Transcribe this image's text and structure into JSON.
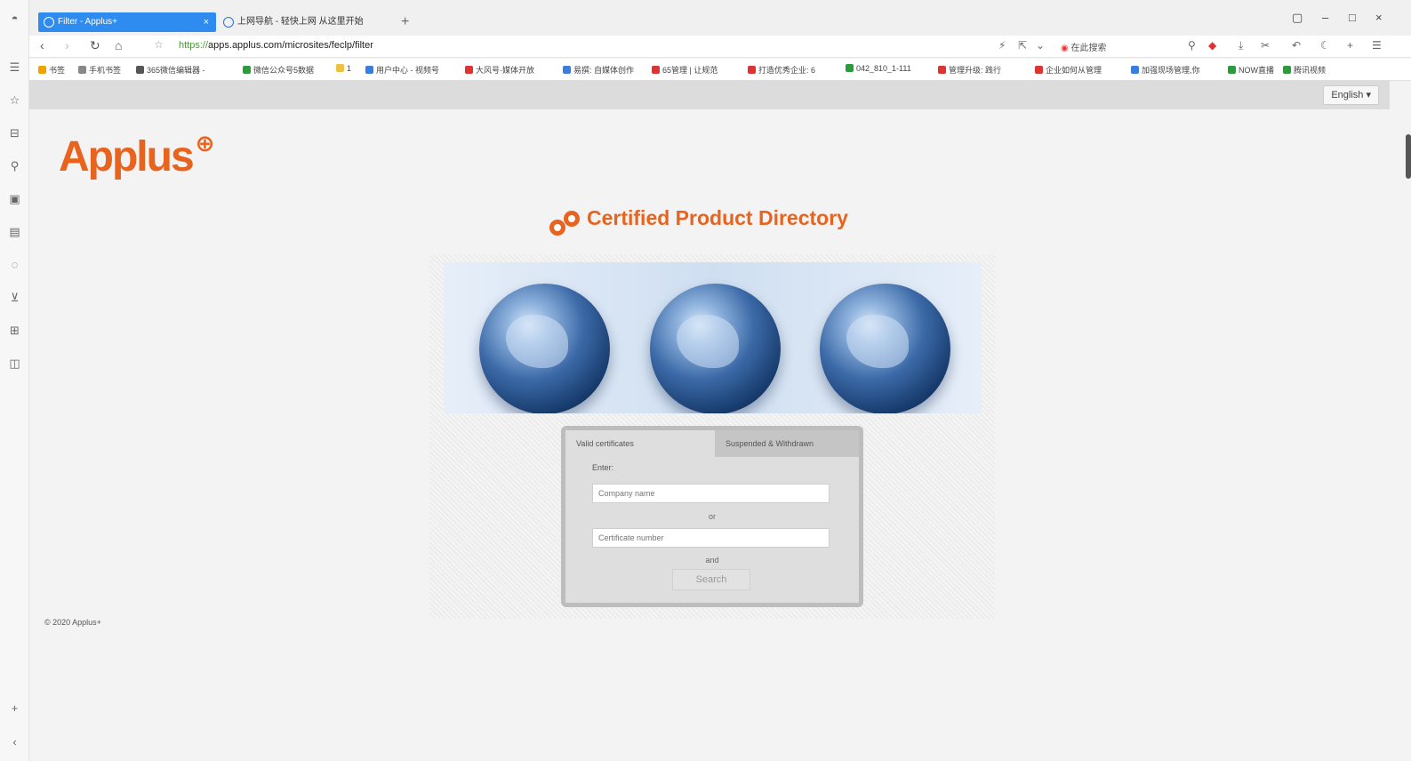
{
  "browser": {
    "tabs": [
      {
        "label": "Filter - Applus+",
        "active": true
      },
      {
        "label": "上网导航 - 轻快上网 从这里开始",
        "active": false
      }
    ],
    "new_tab": "+",
    "url_scheme": "https://",
    "url_rest": "apps.applus.com/microsites/feclp/filter",
    "search_engine": "在此搜索",
    "window_controls": [
      "▢",
      "–",
      "□",
      "×"
    ]
  },
  "bookmarks": [
    {
      "label": "书签",
      "color": "#f2a100"
    },
    {
      "label": "手机书签",
      "color": "#888888"
    },
    {
      "label": "365微信编辑器 -",
      "color": "#555555"
    },
    {
      "label": "微信公众号5数据",
      "color": "#2a9d3a"
    },
    {
      "label": "1",
      "color": "#f0c040"
    },
    {
      "label": "用户中心 - 视频号",
      "color": "#3a7de0"
    },
    {
      "label": "大风号·媒体开放",
      "color": "#d33"
    },
    {
      "label": "易撰: 自媒体创作",
      "color": "#3a7de0"
    },
    {
      "label": "65管理 | 让规范",
      "color": "#d33"
    },
    {
      "label": "打造优秀企业: 6",
      "color": "#d33"
    },
    {
      "label": "042_810_1-111",
      "color": "#2a9d3a"
    },
    {
      "label": "管理升级: 践行",
      "color": "#d33"
    },
    {
      "label": "企业如何从管理",
      "color": "#d33"
    },
    {
      "label": "加强现场管理,你",
      "color": "#3a7de0"
    },
    {
      "label": "NOW直播",
      "color": "#2a9d3a"
    },
    {
      "label": "腾讯视频",
      "color": "#2a9d3a"
    }
  ],
  "page": {
    "language": "English ▾",
    "logo_text": "Applus",
    "logo_mark": "⊕",
    "directory_title": "Certified Product Directory",
    "form": {
      "tab_valid": "Valid certificates",
      "tab_suspended": "Suspended & Withdrawn",
      "enter_label": "Enter:",
      "company_placeholder": "Company name",
      "or_label": "or",
      "cert_placeholder": "Certificate number",
      "and_label": "and",
      "search_label": "Search"
    },
    "copyright": "© 2020 Applus+"
  }
}
